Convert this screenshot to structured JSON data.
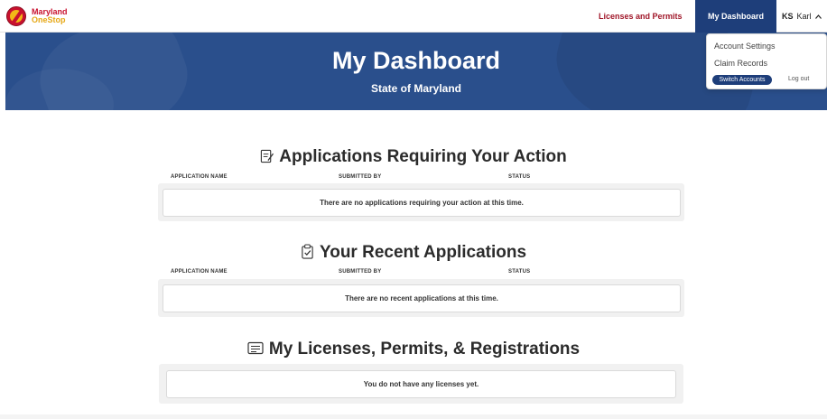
{
  "brand": {
    "line1": "Maryland",
    "line2": "OneStop"
  },
  "nav": {
    "licenses_label": "Licenses and Permits",
    "dashboard_label": "My Dashboard",
    "user_initials": "KS",
    "user_name": "Karl",
    "caret": "^"
  },
  "dropdown": {
    "account_settings": "Account Settings",
    "claim_records": "Claim Records",
    "switch_accounts": "Switch Accounts",
    "log_out": "Log out"
  },
  "hero": {
    "title": "My Dashboard",
    "subtitle": "State of Maryland"
  },
  "sections": {
    "action": {
      "title": "Applications Requiring Your Action",
      "icon": "edit-document-icon",
      "columns": [
        "APPLICATION NAME",
        "SUBMITTED BY",
        "STATUS"
      ],
      "empty_message": "There are no applications requiring your action at this time."
    },
    "recent": {
      "title": "Your Recent Applications",
      "icon": "clipboard-check-icon",
      "columns": [
        "APPLICATION NAME",
        "SUBMITTED BY",
        "STATUS"
      ],
      "empty_message": "There are no recent applications at this time."
    },
    "licenses": {
      "title": "My Licenses, Permits, & Registrations",
      "icon": "id-card-icon",
      "empty_message": "You do not have any licenses yet."
    }
  },
  "colors": {
    "navy": "#1e3e7a",
    "hero": "#2a4f8c",
    "brand_red": "#a01729",
    "brand_gold": "#e6a817"
  }
}
